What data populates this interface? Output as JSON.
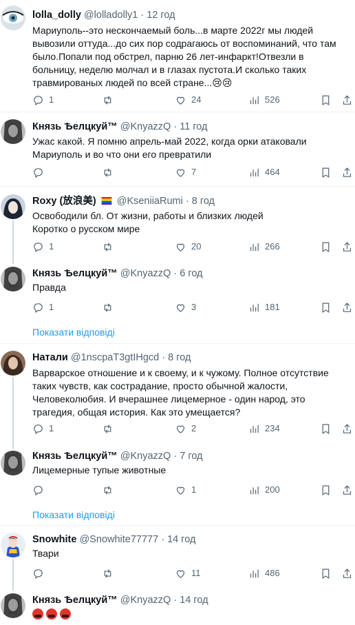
{
  "tweets": [
    {
      "name": "lolla_dolly",
      "handle": "@lolladolly1",
      "dot": "·",
      "time": "12 год",
      "text": "Мариуполь--это нескончаемый боль...в марте 2022г мы людей вывозили оттуда...до сих пор содрагаюсь от воспоминаний, что там было.Попали под обстрел, парню 26 лет-инфаркт!Отвезли в больницу, неделю молчал и в глазах пустота.И сколько таких травмированых людей по всей стране...😢😢",
      "replies": "1",
      "retweets": "",
      "likes": "24",
      "views": "526"
    },
    {
      "name": "Князь Ѣелцкуй™︎",
      "handle": "@KnyazzQ",
      "dot": "·",
      "time": "11 год",
      "text": "Ужас какой. Я помню апрель-май 2022, когда орки атаковали Мариуполь и во что они его превратили",
      "replies": "",
      "retweets": "",
      "likes": "7",
      "views": "464"
    },
    {
      "name": "Roxy (放浪美)",
      "handle": "@KseniiaRumi",
      "dot": "·",
      "time": "8 год",
      "text_lines": [
        "Освободили бл. От жизни, работы и близких людей",
        "Коротко о русском мире"
      ],
      "replies": "1",
      "retweets": "",
      "likes": "20",
      "views": "266"
    },
    {
      "name": "Князь Ѣелцкуй™︎",
      "handle": "@KnyazzQ",
      "dot": "·",
      "time": "6 год",
      "text": "Правда",
      "replies": "1",
      "retweets": "",
      "likes": "3",
      "views": "181",
      "show_replies": "Показати відповіді"
    },
    {
      "name": "Натали",
      "handle": "@1nscpaT3gtIHgcd",
      "dot": "·",
      "time": "8 год",
      "text_lines": [
        "Варварское отношение и к своему, и к чужому. Полное отсутствие таких чувств, как сострадание, просто обычной жалости, Человеколюбия. И вчерашнее лицемерное - один народ, это трагедия, общая история.  Как это умещается?"
      ],
      "replies": "1",
      "retweets": "",
      "likes": "2",
      "views": "234"
    },
    {
      "name": "Князь Ѣелцкуй™︎",
      "handle": "@KnyazzQ",
      "dot": "·",
      "time": "7 год",
      "text": "Лицемерные тупые животные",
      "replies": "",
      "retweets": "",
      "likes": "1",
      "views": "200",
      "show_replies": "Показати відповіді"
    },
    {
      "name": "Snowhite",
      "handle": "@Snowhite77777",
      "dot": "·",
      "time": "14 год",
      "text": "Твари",
      "replies": "",
      "retweets": "",
      "likes": "11",
      "views": "486"
    },
    {
      "name": "Князь Ѣелцкуй™︎",
      "handle": "@KnyazzQ",
      "dot": "·",
      "time": "14 год",
      "emoji_reactions": [
        "angry-face",
        "angry-face",
        "angry-face"
      ]
    }
  ],
  "colors": {
    "link": "#1d9bf0",
    "muted": "#536471",
    "divider": "#eff3f4"
  },
  "icons": [
    "reply-icon",
    "retweet-icon",
    "like-icon",
    "views-icon",
    "bookmark-icon",
    "share-icon"
  ]
}
